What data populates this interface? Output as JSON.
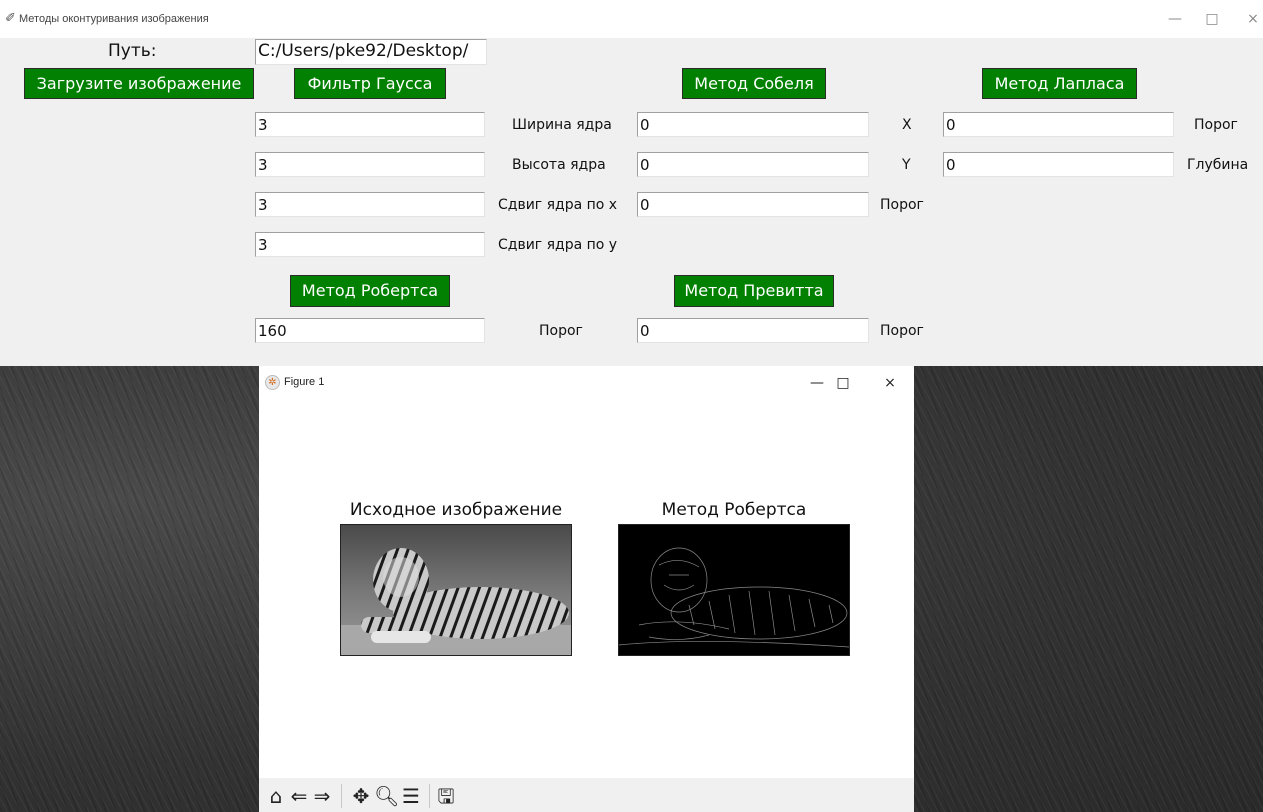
{
  "window": {
    "title": "Методы оконтуривания изображения"
  },
  "path": {
    "label": "Путь:",
    "value": "C:/Users/pke92/Desktop/"
  },
  "buttons": {
    "load": "Загрузите изображение",
    "gauss": "Фильтр Гаусса",
    "sobel": "Метод Собеля",
    "laplace": "Метод Лапласа",
    "roberts": "Метод Робертса",
    "prewitt": "Метод Превитта"
  },
  "gauss": {
    "fields": [
      {
        "value": "3",
        "label": "Ширина ядра"
      },
      {
        "value": "3",
        "label": "Высота ядра"
      },
      {
        "value": "3",
        "label": "Сдвиг ядра по x"
      },
      {
        "value": "3",
        "label": "Сдвиг ядра по y"
      }
    ]
  },
  "sobel": {
    "fields": [
      {
        "value": "0",
        "label": "X"
      },
      {
        "value": "0",
        "label": "Y"
      },
      {
        "value": "0",
        "label": "Порог"
      }
    ]
  },
  "laplace": {
    "fields": [
      {
        "value": "0",
        "label": "Порог"
      },
      {
        "value": "0",
        "label": "Глубина"
      }
    ]
  },
  "roberts": {
    "value": "160",
    "label": "Порог"
  },
  "prewitt": {
    "value": "0",
    "label": "Порог"
  },
  "figure": {
    "title": "Figure 1",
    "plots": [
      {
        "title": "Исходное изображение"
      },
      {
        "title": "Метод Робертса"
      }
    ],
    "toolbar": [
      "home-icon",
      "back-icon",
      "forward-icon",
      "pan-icon",
      "zoom-icon",
      "configure-subplots-icon",
      "save-icon"
    ]
  },
  "icons": {
    "window_buttons": [
      "minimize-icon",
      "maximize-icon",
      "close-icon"
    ]
  },
  "colors": {
    "button_bg": "#018001",
    "button_text": "#ffffff",
    "panel_bg": "#f0f0f0"
  }
}
